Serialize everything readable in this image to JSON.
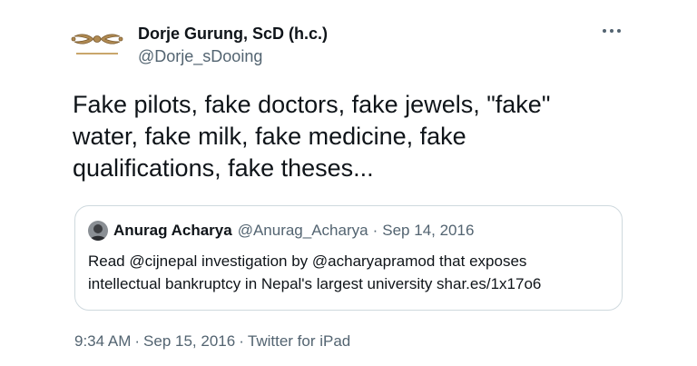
{
  "tweet": {
    "display_name": "Dorje Gurung, ScD (h.c.)",
    "handle": "@Dorje_sDooing",
    "avatar_icon": "vajra-icon",
    "more_icon": "more-options-icon",
    "text_lines": [
      "Fake pilots, fake doctors, fake jewels, \"fake\"",
      "water, fake milk, fake medicine, fake",
      "qualifications, fake theses..."
    ],
    "time": "9:34 AM",
    "date": "Sep 15, 2016",
    "source": "Twitter for iPad",
    "separator": "·"
  },
  "quote": {
    "display_name": "Anurag Acharya",
    "handle": "@Anurag_Acharya",
    "separator": "·",
    "date": "Sep 14, 2016",
    "text_lines": [
      "Read @cijnepal investigation by @acharyapramod that exposes",
      "intellectual bankruptcy in Nepal's largest university shar.es/1x17o6"
    ]
  },
  "colors": {
    "primary_text": "#0f1419",
    "secondary_text": "#536471",
    "border": "#cfd9de",
    "background": "#ffffff"
  }
}
